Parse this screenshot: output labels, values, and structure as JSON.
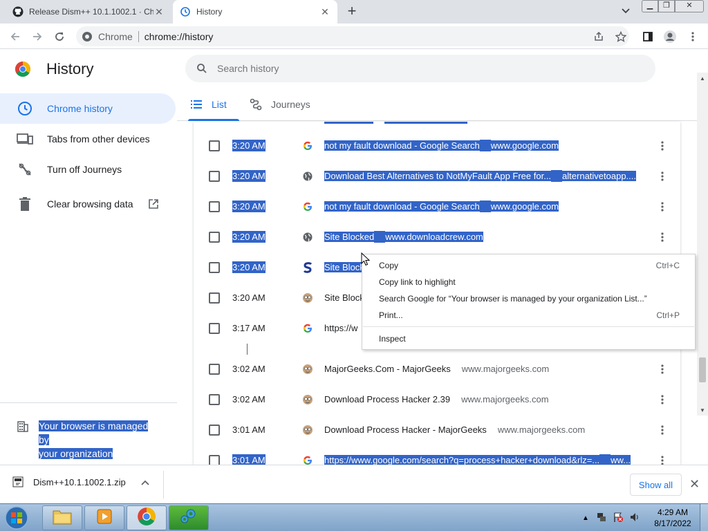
{
  "tabs": [
    {
      "title": "Release Dism++ 10.1.1002.1 · Ch",
      "active": false,
      "icon": "github-icon"
    },
    {
      "title": "History",
      "active": true,
      "icon": "history-icon"
    }
  ],
  "toolbar": {
    "chip": "Chrome",
    "url": "chrome://history"
  },
  "page": {
    "title": "History",
    "search_placeholder": "Search history"
  },
  "sidebar": {
    "items": [
      {
        "label": "Chrome history",
        "icon": "clock-icon",
        "selected": true
      },
      {
        "label": "Tabs from other devices",
        "icon": "devices-icon",
        "selected": false
      },
      {
        "label": "Turn off Journeys",
        "icon": "journeys-off-icon",
        "selected": false
      },
      {
        "label": "Clear browsing data",
        "icon": "trash-icon",
        "selected": false
      }
    ],
    "managed": {
      "line1": "Your browser is managed by",
      "line2": "your organization"
    }
  },
  "view_tabs": [
    {
      "label": "List",
      "active": true
    },
    {
      "label": "Journeys",
      "active": false
    }
  ],
  "history": [
    {
      "time": "3:20 AM",
      "favicon": "google-icon",
      "title": "not my fault download - Google Search",
      "domain": "www.google.com",
      "selected": true
    },
    {
      "time": "3:20 AM",
      "favicon": "globe-icon",
      "title": "Download Best Alternatives to NotMyFault App Free for...",
      "domain": "alternativetoapp....",
      "selected": true
    },
    {
      "time": "3:20 AM",
      "favicon": "google-icon",
      "title": "not my fault download - Google Search",
      "domain": "www.google.com",
      "selected": true
    },
    {
      "time": "3:20 AM",
      "favicon": "globe-icon",
      "title": "Site Blocked",
      "domain": "www.downloadcrew.com",
      "selected": true
    },
    {
      "time": "3:20 AM",
      "favicon": "softpedia-icon",
      "title": "Site Block",
      "domain": "",
      "selected": true
    },
    {
      "time": "3:20 AM",
      "favicon": "majorgeeks-icon",
      "title": "Site Block",
      "domain": "",
      "selected": false
    },
    {
      "time": "3:17 AM",
      "favicon": "google-icon",
      "title": "https://w",
      "domain": "",
      "selected": false
    },
    {
      "time": "3:02 AM",
      "favicon": "majorgeeks-icon",
      "title": "MajorGeeks.Com - MajorGeeks",
      "domain": "www.majorgeeks.com",
      "selected": false
    },
    {
      "time": "3:02 AM",
      "favicon": "majorgeeks-icon",
      "title": "Download Process Hacker 2.39",
      "domain": "www.majorgeeks.com",
      "selected": false
    },
    {
      "time": "3:01 AM",
      "favicon": "majorgeeks-icon",
      "title": "Download Process Hacker - MajorGeeks",
      "domain": "www.majorgeeks.com",
      "selected": false
    },
    {
      "time": "3:01 AM",
      "favicon": "google-icon",
      "title": "https://www.google.com/search?q=process+hacker+download&rlz=...",
      "domain": "ww...",
      "selected": true
    }
  ],
  "context_menu": {
    "items": [
      {
        "label": "Copy",
        "shortcut": "Ctrl+C"
      },
      {
        "label": "Copy link to highlight",
        "shortcut": ""
      },
      {
        "label": "Search Google for “Your browser is managed by your organization List...”",
        "shortcut": ""
      },
      {
        "label": "Print...",
        "shortcut": "Ctrl+P"
      },
      {
        "label": "Inspect",
        "shortcut": ""
      }
    ]
  },
  "download": {
    "filename": "Dism++10.1.1002.1.zip",
    "show_all": "Show all"
  },
  "taskbar": {
    "time": "4:29 AM",
    "date": "8/17/2022"
  },
  "colors": {
    "accent": "#1a73e8",
    "selection": "#3264c8",
    "nav_selected_bg": "#e8f0fe"
  }
}
